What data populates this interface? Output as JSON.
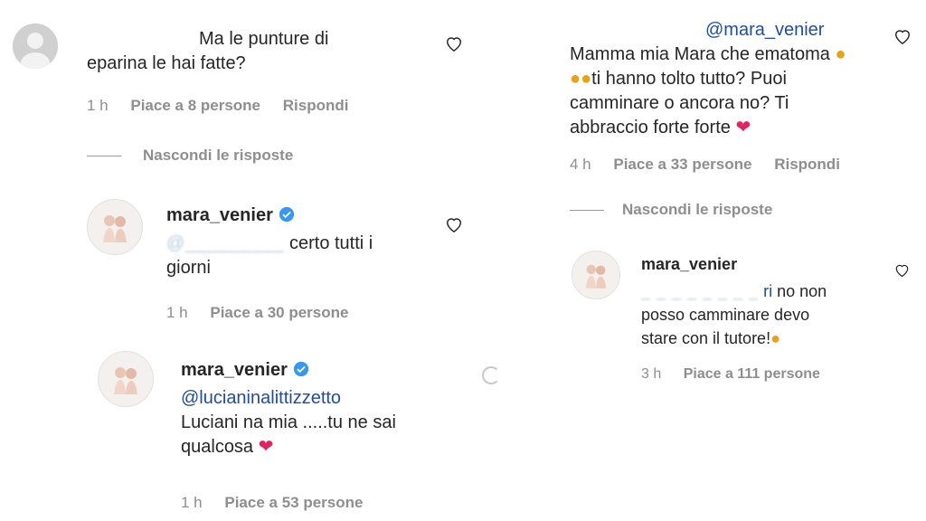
{
  "left": {
    "comment": {
      "text_line1": "Ma le punture di",
      "text_line2": "eparina le hai fatte?",
      "time": "1 h",
      "likes": "Piace a 8 persone",
      "reply": "Rispondi"
    },
    "hide_replies": "Nascondi le risposte",
    "reply1": {
      "username": "mara_venier",
      "mention_blur": "@_________",
      "text_line1": " certo tutti i",
      "text_line2": "giorni",
      "time": "1 h",
      "likes": "Piace a 30 persone"
    },
    "reply2": {
      "username": "mara_venier",
      "mention": "@lucianinalittizzetto",
      "text_line1": "Luciani na mia .....tu ne sai",
      "text_line2": "qualcosa",
      "time": "1 h",
      "likes": "Piace a 53 persone"
    }
  },
  "right": {
    "comment": {
      "mention": "@mara_venier",
      "text_line1": "Mamma mia Mara che ematoma",
      "text_line2": "ti hanno tolto tutto? Puoi",
      "text_line3": "camminare o ancora no? Ti",
      "text_line4": "abbraccio forte forte",
      "time": "4 h",
      "likes": "Piace a 33 persone",
      "reply": "Rispondi"
    },
    "hide_replies": "Nascondi le risposte",
    "reply1": {
      "username": "mara_venier",
      "mention_blur": "_ _ _ _ _ _ _ _",
      "mention_tail": "ri",
      "text_line1": " no non",
      "text_line2": "posso camminare devo",
      "text_line3": "stare con il tutore!",
      "time": "3 h",
      "likes": "Piace a 111 persone"
    }
  },
  "icons": {
    "heart": "heart-icon",
    "verified": "verified-badge-icon",
    "emoji_scream": "😱",
    "emoji_heart": "❤️",
    "emoji_cry": "😢"
  },
  "colors": {
    "text": "#262626",
    "meta": "#8e8e8e",
    "mention": "#1f4e9d",
    "verified": "#3897f0",
    "heart_emoji": "#e0245e"
  }
}
